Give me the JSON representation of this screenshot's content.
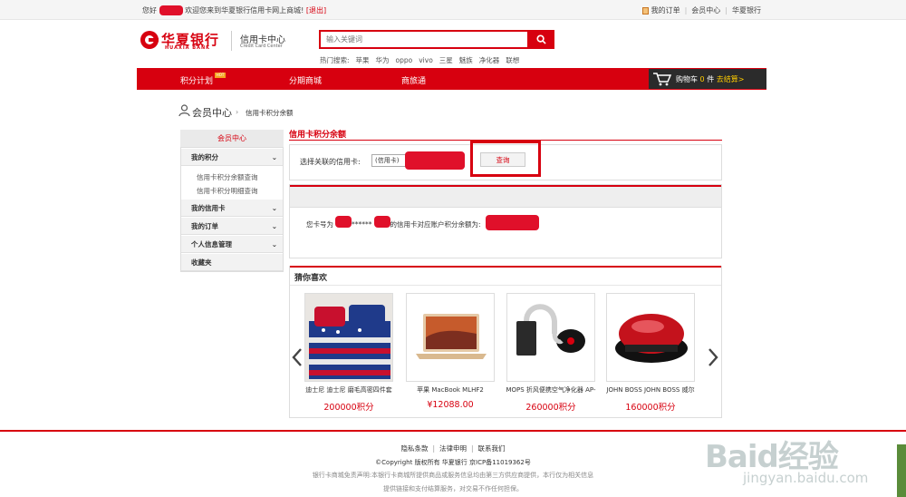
{
  "topbar": {
    "hello": "您好",
    "welcome": "欢迎您来到华夏银行信用卡网上商城!",
    "logout": "[退出]",
    "links": [
      "我的订单",
      "会员中心",
      "华夏银行"
    ]
  },
  "header": {
    "logo_cn": "华夏银行",
    "logo_en": "HUAXIA BANK",
    "cc_title": "信用卡中心",
    "cc_subtitle": "Credit Card Center",
    "search_placeholder": "输入关键词",
    "hot_label": "热门搜索:",
    "hot_words": [
      "苹果",
      "华为",
      "oppo",
      "vivo",
      "三星",
      "魅族",
      "净化器",
      "联想"
    ]
  },
  "nav": {
    "items": [
      "积分计划",
      "分期商城",
      "商旅通"
    ],
    "hot_badge": "HOT",
    "cart_label": "购物车",
    "cart_count": "0",
    "cart_unit": "件",
    "checkout": "去结算>"
  },
  "breadcrumb": {
    "root": "会员中心",
    "current": "信用卡积分余额"
  },
  "sidebar": {
    "header": "会员中心",
    "sections": [
      {
        "label": "我的积分",
        "children": [
          "信用卡积分余额查询",
          "信用卡积分明细查询"
        ]
      },
      {
        "label": "我的信用卡"
      },
      {
        "label": "我的订单"
      },
      {
        "label": "个人信息管理"
      },
      {
        "label": "收藏夹"
      }
    ]
  },
  "content": {
    "title": "信用卡积分余额",
    "select_label": "选择关联的信用卡:",
    "select_value": "(信用卡)",
    "query_button": "查询",
    "balance_prefix": "您卡号为",
    "balance_mask": "******",
    "balance_suffix": "的信用卡对应账户积分余额为:"
  },
  "guess": {
    "title": "猜你喜欢",
    "products": [
      {
        "name": "迪士尼 迪士尼 磨毛高密四件套",
        "price": "200000积分"
      },
      {
        "name": "苹果 MacBook MLHF2",
        "price": "¥12088.00"
      },
      {
        "name": "MOPS 折风便携空气净化器 AP-",
        "price": "260000积分"
      },
      {
        "name": "JOHN BOSS JOHN BOSS 威尔",
        "price": "160000积分"
      }
    ]
  },
  "footer": {
    "links": [
      "隐私条款",
      "法律申明",
      "联系我们"
    ],
    "copyright": "©Copyright 版权所有 华夏银行 京ICP备11019362号",
    "disclaimer1": "银行卡商城免责声明:本银行卡商城所提供商品或服务信息均由第三方供应商提供，本行仅为相关信息",
    "disclaimer2": "提供链接和支付结算服务，对交易不作任何担保。"
  },
  "watermark": {
    "line1": "Baid经验",
    "line2": "jingyan.baidu.com"
  },
  "colors": {
    "brand_red": "#d7000f",
    "cart_bg": "#2b2b2b",
    "checkout_yellow": "#ffcc00"
  }
}
